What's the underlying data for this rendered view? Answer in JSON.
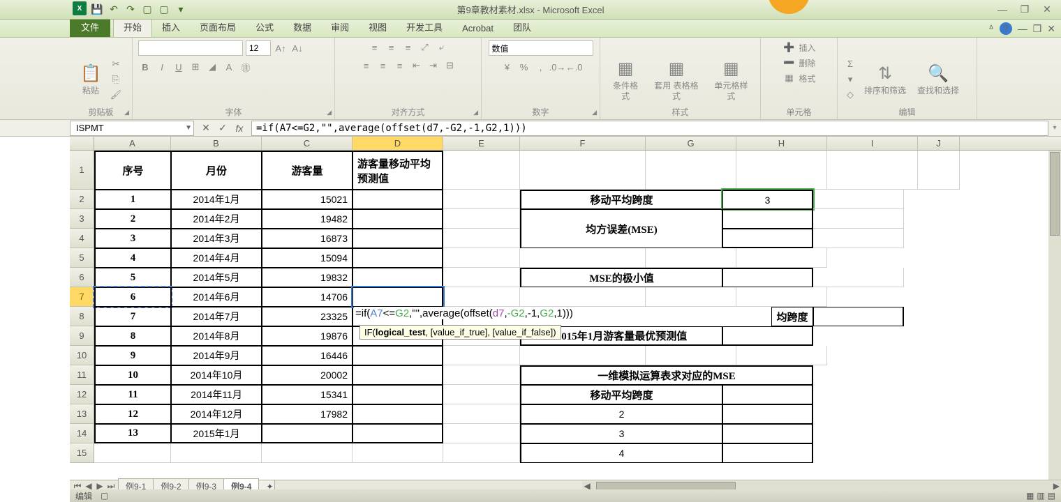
{
  "app": {
    "title": "第9章教材素材.xlsx - Microsoft Excel",
    "file_tab": "文件"
  },
  "qat": {
    "save": "💾",
    "undo": "↶",
    "redo": "↷",
    "new": "▢",
    "open": "▢",
    "more": "▾"
  },
  "win": {
    "min": "—",
    "max": "❐",
    "close": "✕",
    "rmin": "—",
    "rmax": "❐",
    "rclose": "✕"
  },
  "tabs": [
    "开始",
    "插入",
    "页面布局",
    "公式",
    "数据",
    "审阅",
    "视图",
    "开发工具",
    "Acrobat",
    "团队"
  ],
  "ribbon": {
    "clipboard": {
      "label": "剪贴板",
      "paste": "粘贴"
    },
    "font": {
      "label": "字体",
      "size": "12"
    },
    "alignment": {
      "label": "对齐方式"
    },
    "number": {
      "label": "数字",
      "format": "数值"
    },
    "styles": {
      "label": "样式",
      "cond": "条件格式",
      "table": "套用\n表格格式",
      "cell": "单元格样式"
    },
    "cells": {
      "label": "单元格",
      "insert": "插入",
      "delete": "删除",
      "format": "格式"
    },
    "editing": {
      "label": "编辑",
      "sort": "排序和筛选",
      "find": "查找和选择"
    }
  },
  "namebox": "ISPMT",
  "formula": "=if(A7<=G2,\"\",average(offset(d7,-G2,-1,G2,1)))",
  "formula_display": {
    "prefix": "=if(",
    "r1": "A7",
    "op": "<=",
    "r2": "G2",
    "mid": ",\"\",average(offset(",
    "r3": "d7",
    "c": ",",
    "r4": "-G2",
    "c2": ",-1,",
    "r5": "G2",
    "end": ",1)))"
  },
  "tooltip": "IF(logical_test, [value_if_true], [value_if_false])",
  "cols": [
    "A",
    "B",
    "C",
    "D",
    "E",
    "F",
    "G",
    "H",
    "I",
    "J"
  ],
  "headers": {
    "A": "序号",
    "B": "月份",
    "C": "游客量",
    "D": "游客量移动平均预测值"
  },
  "data_rows": [
    {
      "n": "1",
      "a": "1",
      "b": "2014年1月",
      "c": "15021"
    },
    {
      "n": "2",
      "a": "2",
      "b": "2014年2月",
      "c": "19482"
    },
    {
      "n": "3",
      "a": "3",
      "b": "2014年3月",
      "c": "16873"
    },
    {
      "n": "4",
      "a": "4",
      "b": "2014年4月",
      "c": "15094"
    },
    {
      "n": "5",
      "a": "5",
      "b": "2014年5月",
      "c": "19832"
    },
    {
      "n": "6",
      "a": "6",
      "b": "2014年6月",
      "c": "14706"
    },
    {
      "n": "7",
      "a": "7",
      "b": "2014年7月",
      "c": "23325"
    },
    {
      "n": "8",
      "a": "8",
      "b": "2014年8月",
      "c": "19876"
    },
    {
      "n": "9",
      "a": "9",
      "b": "2014年9月",
      "c": "16446"
    },
    {
      "n": "10",
      "a": "10",
      "b": "2014年10月",
      "c": "20002"
    },
    {
      "n": "11",
      "a": "11",
      "b": "2014年11月",
      "c": "15341"
    },
    {
      "n": "12",
      "a": "12",
      "b": "2014年12月",
      "c": "17982"
    },
    {
      "n": "13",
      "a": "13",
      "b": "2015年1月",
      "c": ""
    }
  ],
  "side": {
    "span_label": "移动平均跨度",
    "span_val": "3",
    "mse_label": "均方误差(MSE)",
    "min_label": "MSE的极小值",
    "opt_span": "均跨度",
    "pred_label": "2015年1月游客量最优预测值",
    "sim_title": "一维模拟运算表求对应的MSE",
    "sim_span": "移动平均跨度",
    "s2": "2",
    "s3": "3",
    "s4": "4"
  },
  "sheets": {
    "s1": "例9-1",
    "s2": "例9-2",
    "s3": "例9-3",
    "s4": "例9-4"
  },
  "status": "编辑"
}
